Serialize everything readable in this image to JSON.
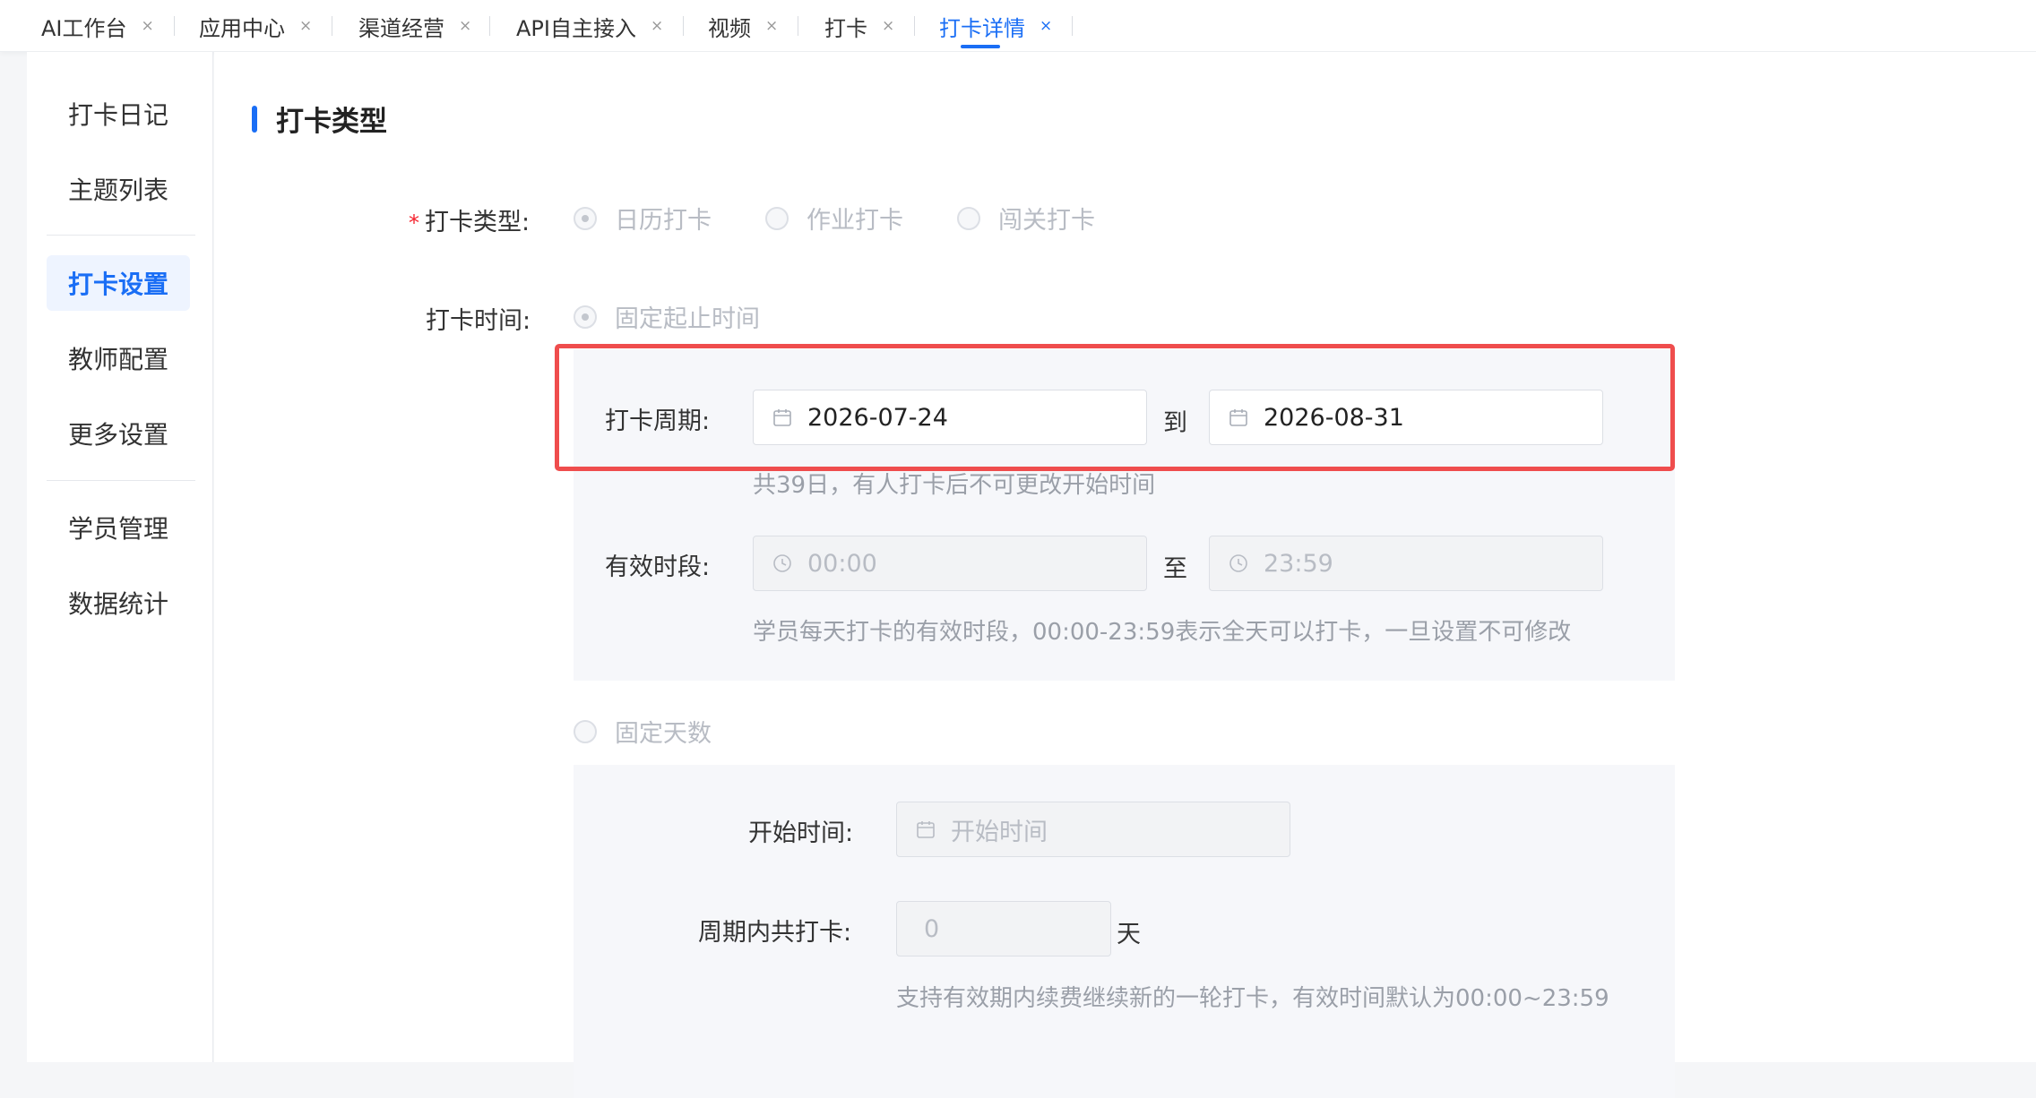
{
  "tabs": [
    {
      "label": "AI工作台",
      "close": "×"
    },
    {
      "label": "应用中心",
      "close": "×"
    },
    {
      "label": "渠道经营",
      "close": "×"
    },
    {
      "label": "API自主接入",
      "close": "×"
    },
    {
      "label": "视频",
      "close": "×"
    },
    {
      "label": "打卡",
      "close": "×"
    },
    {
      "label": "打卡详情",
      "close": "×"
    }
  ],
  "sidebar": {
    "items": [
      {
        "label": "打卡日记"
      },
      {
        "label": "主题列表"
      },
      {
        "label": "打卡设置"
      },
      {
        "label": "教师配置"
      },
      {
        "label": "更多设置"
      },
      {
        "label": "学员管理"
      },
      {
        "label": "数据统计"
      }
    ]
  },
  "main": {
    "section_title": "打卡类型",
    "type_field": {
      "required_mark": "*",
      "label": "打卡类型:",
      "options": [
        "日历打卡",
        "作业打卡",
        "闯关打卡"
      ]
    },
    "time_field": {
      "label": "打卡时间:",
      "option_fixed_range": "固定起止时间",
      "option_fixed_days": "固定天数"
    },
    "period": {
      "label": "打卡周期:",
      "start_date": "2026-07-24",
      "separator": "到",
      "end_date": "2026-08-31",
      "hint": "共39日，有人打卡后不可更改开始时间"
    },
    "valid_time": {
      "label": "有效时段:",
      "start": "00:00",
      "separator": "至",
      "end": "23:59",
      "hint": "学员每天打卡的有效时段，00:00-23:59表示全天可以打卡，一旦设置不可修改"
    },
    "fixed_days": {
      "start_label": "开始时间:",
      "start_placeholder": "开始时间",
      "count_label": "周期内共打卡:",
      "count_value": "0",
      "count_unit": "天",
      "hint": "支持有效期内续费继续新的一轮打卡，有效时间默认为00:00~23:59"
    }
  },
  "colors": {
    "accent": "#1a6ef5",
    "highlight": "#ef4d4d",
    "required": "#f5222d"
  }
}
